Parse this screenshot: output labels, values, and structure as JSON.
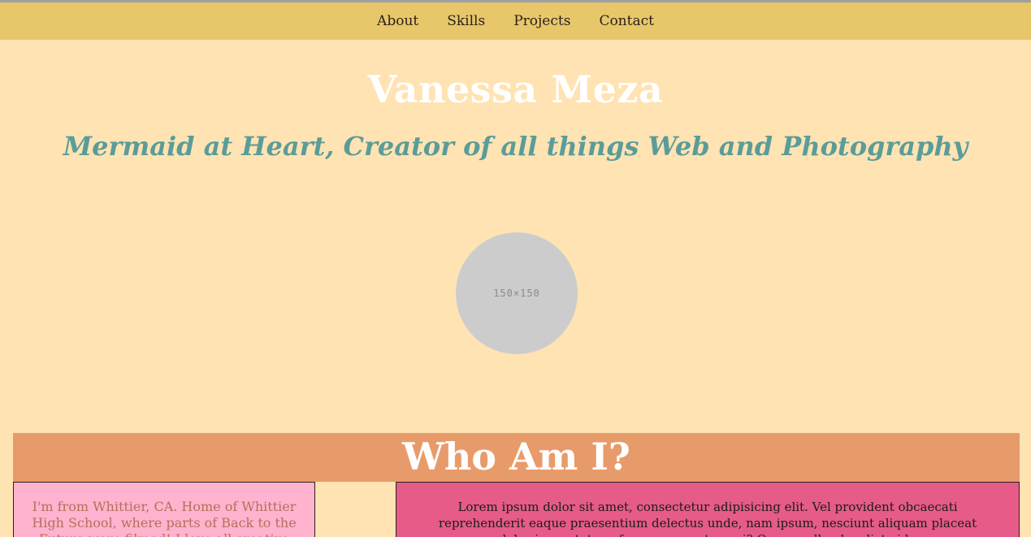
{
  "nav": {
    "items": [
      {
        "label": "About"
      },
      {
        "label": "Skills"
      },
      {
        "label": "Projects"
      },
      {
        "label": "Contact"
      }
    ]
  },
  "hero": {
    "name": "Vanessa Meza",
    "tagline": "Mermaid at Heart, Creator of all things Web and Photography",
    "avatar_placeholder": "150×150"
  },
  "about": {
    "heading": "Who Am I?",
    "bio": "I'm from Whittier, CA. Home of Whittier High School, where parts of Back to the Future were filmed! I love all creative things.",
    "lorem": "Lorem ipsum dolor sit amet, consectetur adipisicing elit. Vel provident obcaecati reprehenderit eaque praesentium delectus unde, nam ipsum, nesciunt aliquam placeat laboriosam totam, facere quaerat sequi? Quo repellendus dicta id."
  },
  "colors": {
    "background": "#ffe3b3",
    "navbar": "#e8c76b",
    "title": "#ffffff",
    "tagline": "#5b9c99",
    "heading_bar": "#e89b6a",
    "bio_card": "#ffb3cf",
    "lorem_card": "#e65b88"
  }
}
